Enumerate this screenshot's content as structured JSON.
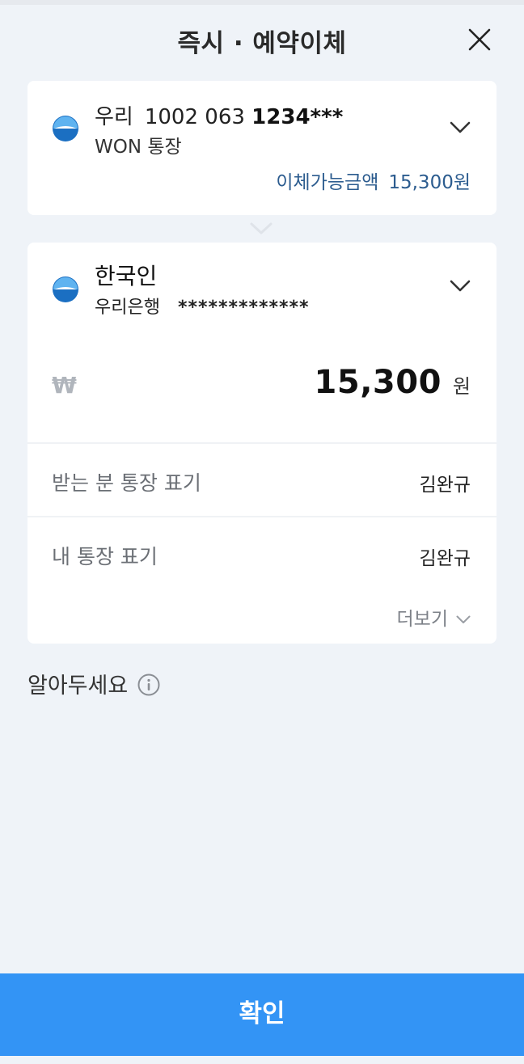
{
  "header": {
    "title": "즉시 · 예약이체",
    "close_icon": "close-icon"
  },
  "from_account": {
    "bank": "우리",
    "account_prefix": "1002 063",
    "account_suffix": "1234***",
    "account_type": "WON 통장",
    "available_label": "이체가능금액",
    "available_amount": "15,300원"
  },
  "to_account": {
    "name": "한국인",
    "bank": "우리은행",
    "account_number": "*************"
  },
  "amount": {
    "currency_symbol": "₩",
    "value": "15,300",
    "unit": "원"
  },
  "fields": {
    "receiver_memo_label": "받는 분 통장 표기",
    "receiver_memo_value": "김완규",
    "my_memo_label": "내 통장 표기",
    "my_memo_value": "김완규",
    "more_label": "더보기"
  },
  "notice": {
    "label": "알아두세요",
    "icon": "info-icon"
  },
  "confirm_button": {
    "label": "확인"
  },
  "colors": {
    "background": "#eff3f8",
    "card": "#ffffff",
    "accent_blue": "#3394f5",
    "available_text": "#2c5c8f",
    "bank_logo_blue": "#1b6fc2"
  }
}
